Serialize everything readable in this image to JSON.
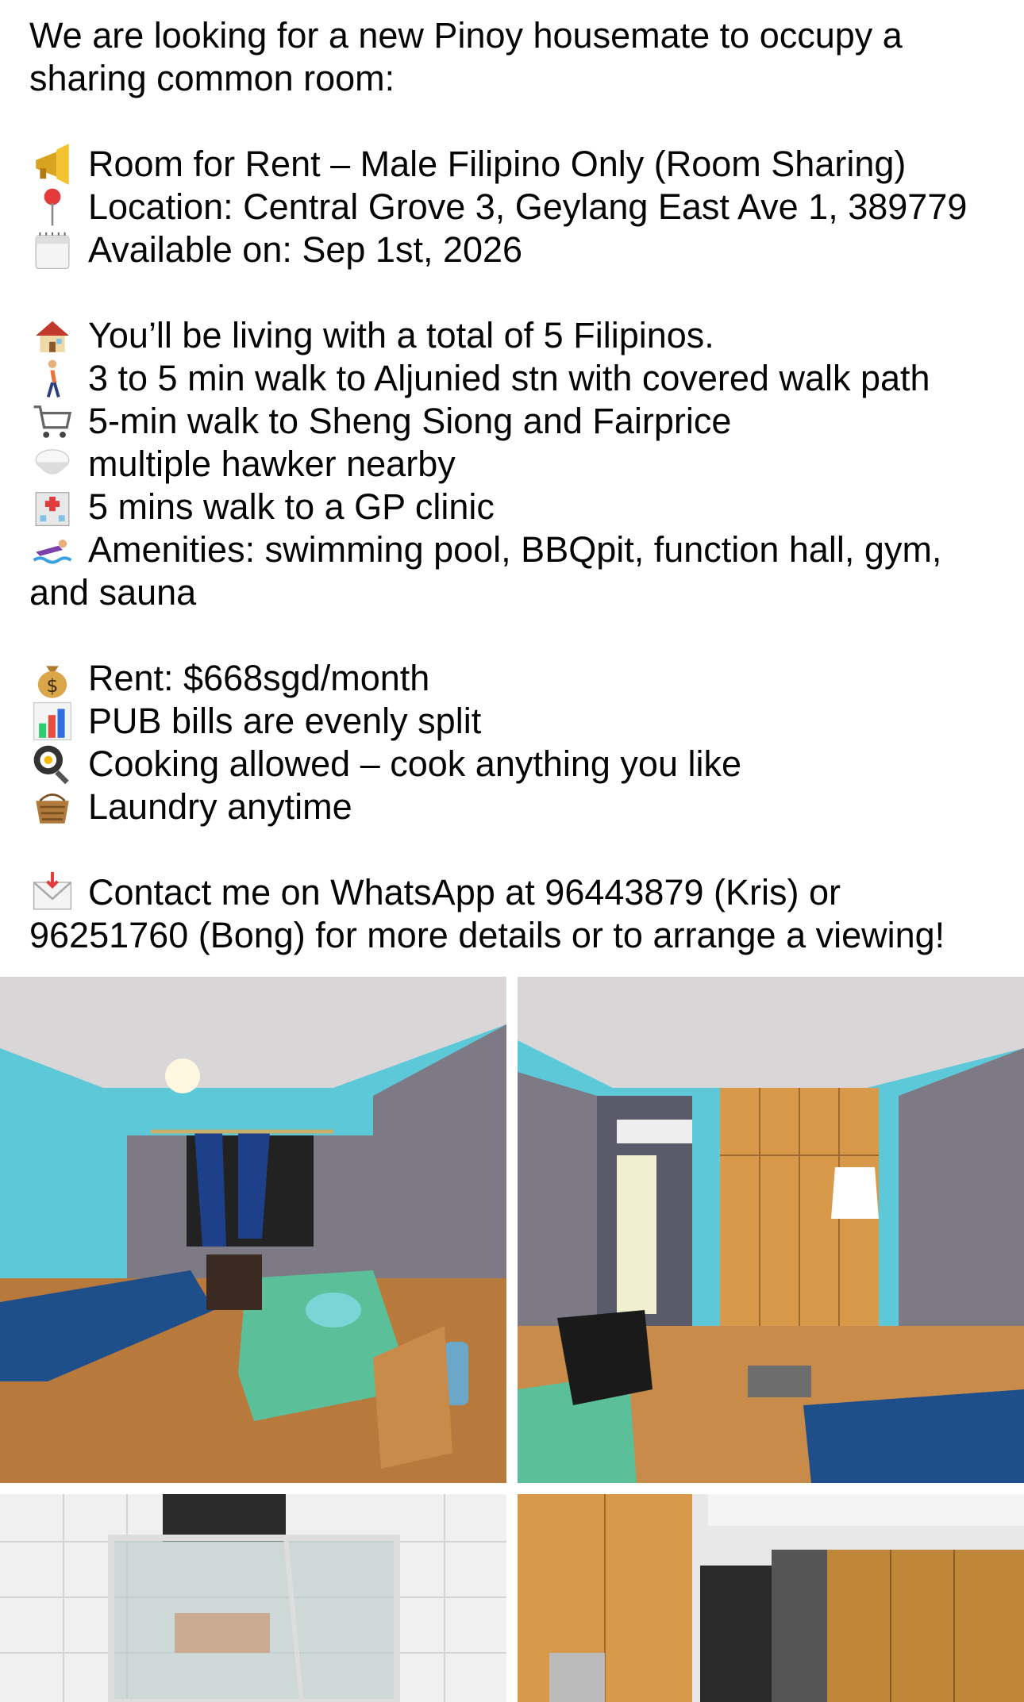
{
  "post": {
    "intro": "We are looking for a new Pinoy housemate to occupy a sharing common room:",
    "listing": [
      {
        "icon": "megaphone-icon",
        "text": "Room for Rent – Male Filipino Only (Room Sharing)"
      },
      {
        "icon": "pin-icon",
        "text": "Location: Central Grove 3, Geylang East Ave 1, 389779"
      },
      {
        "icon": "calendar-icon",
        "text": "Available on: Sep 1st, 2026"
      }
    ],
    "features": [
      {
        "icon": "house-icon",
        "text": "You’ll be living with a total of 5 Filipinos."
      },
      {
        "icon": "walking-person-icon",
        "text": "3 to 5 min walk to Aljunied stn with covered walk path"
      },
      {
        "icon": "shopping-cart-icon",
        "text": "5-min walk to Sheng Siong and Fairprice"
      },
      {
        "icon": "rice-bowl-icon",
        "text": "multiple hawker nearby"
      },
      {
        "icon": "hospital-icon",
        "text": "5 mins walk to a GP clinic"
      },
      {
        "icon": "swimmer-icon",
        "text": "Amenities: swimming pool, BBQpit, function hall, gym, and sauna"
      }
    ],
    "costs": [
      {
        "icon": "money-bag-icon",
        "text": "Rent: $668sgd/month"
      },
      {
        "icon": "bar-chart-icon",
        "text": "PUB bills are evenly split"
      },
      {
        "icon": "frying-pan-icon",
        "text": "Cooking allowed – cook anything you like"
      },
      {
        "icon": "laundry-basket-icon",
        "text": "Laundry anytime"
      }
    ],
    "contact": {
      "icon": "envelope-icon",
      "text": "Contact me on WhatsApp at 96443879 (Kris) or 96251760 (Bong) for more details or to arrange a viewing!"
    }
  },
  "colors": {
    "text": "#050505",
    "wall_blue": "#5cc8d8",
    "wall_grey": "#7d7a86",
    "floor_wood": "#b87a3c",
    "bedsheet_blue": "#1e4f8a",
    "bedsheet_green": "#5bbf9a",
    "wardrobe": "#d89a4a"
  },
  "photos": [
    {
      "name": "bedroom-photo-window"
    },
    {
      "name": "bedroom-photo-wardrobe"
    },
    {
      "name": "bathroom-photo"
    },
    {
      "name": "kitchen-photo"
    }
  ]
}
